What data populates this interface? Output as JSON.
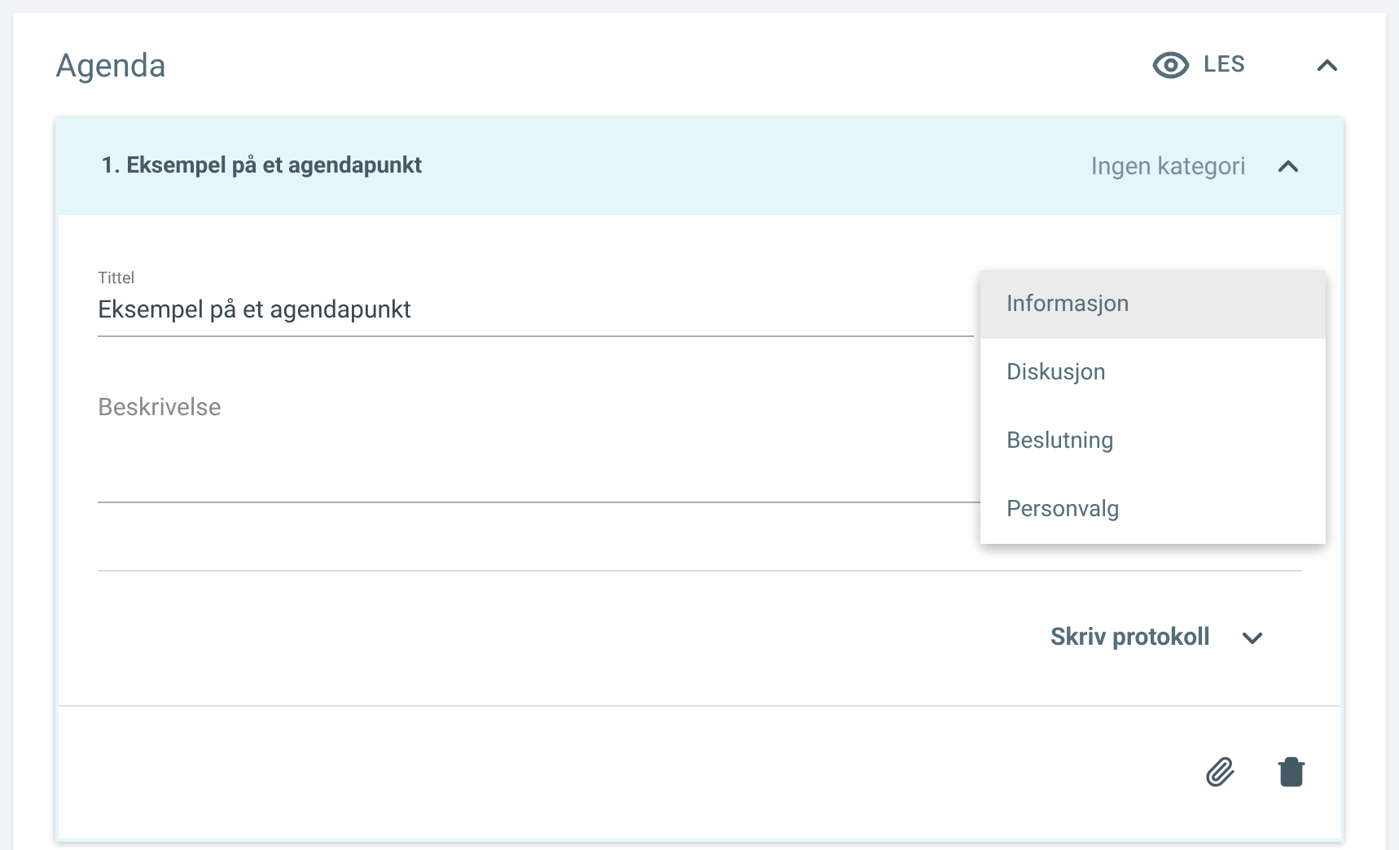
{
  "panel": {
    "title": "Agenda",
    "view_mode": "LES",
    "expanded": true
  },
  "agenda_item": {
    "title": "1. Eksempel på et agendapunkt",
    "category": "Ingen kategori",
    "expanded": true,
    "fields": {
      "title_label": "Tittel",
      "title_value": "Eksempel på et agendapunkt",
      "description_placeholder": "Beskrivelse"
    },
    "protocol": {
      "label": "Skriv protokoll",
      "expanded": false
    }
  },
  "category_menu": [
    {
      "label": "Informasjon",
      "selected": true
    },
    {
      "label": "Diskusjon",
      "selected": false
    },
    {
      "label": "Beslutning",
      "selected": false
    },
    {
      "label": "Personvalg",
      "selected": false
    }
  ]
}
